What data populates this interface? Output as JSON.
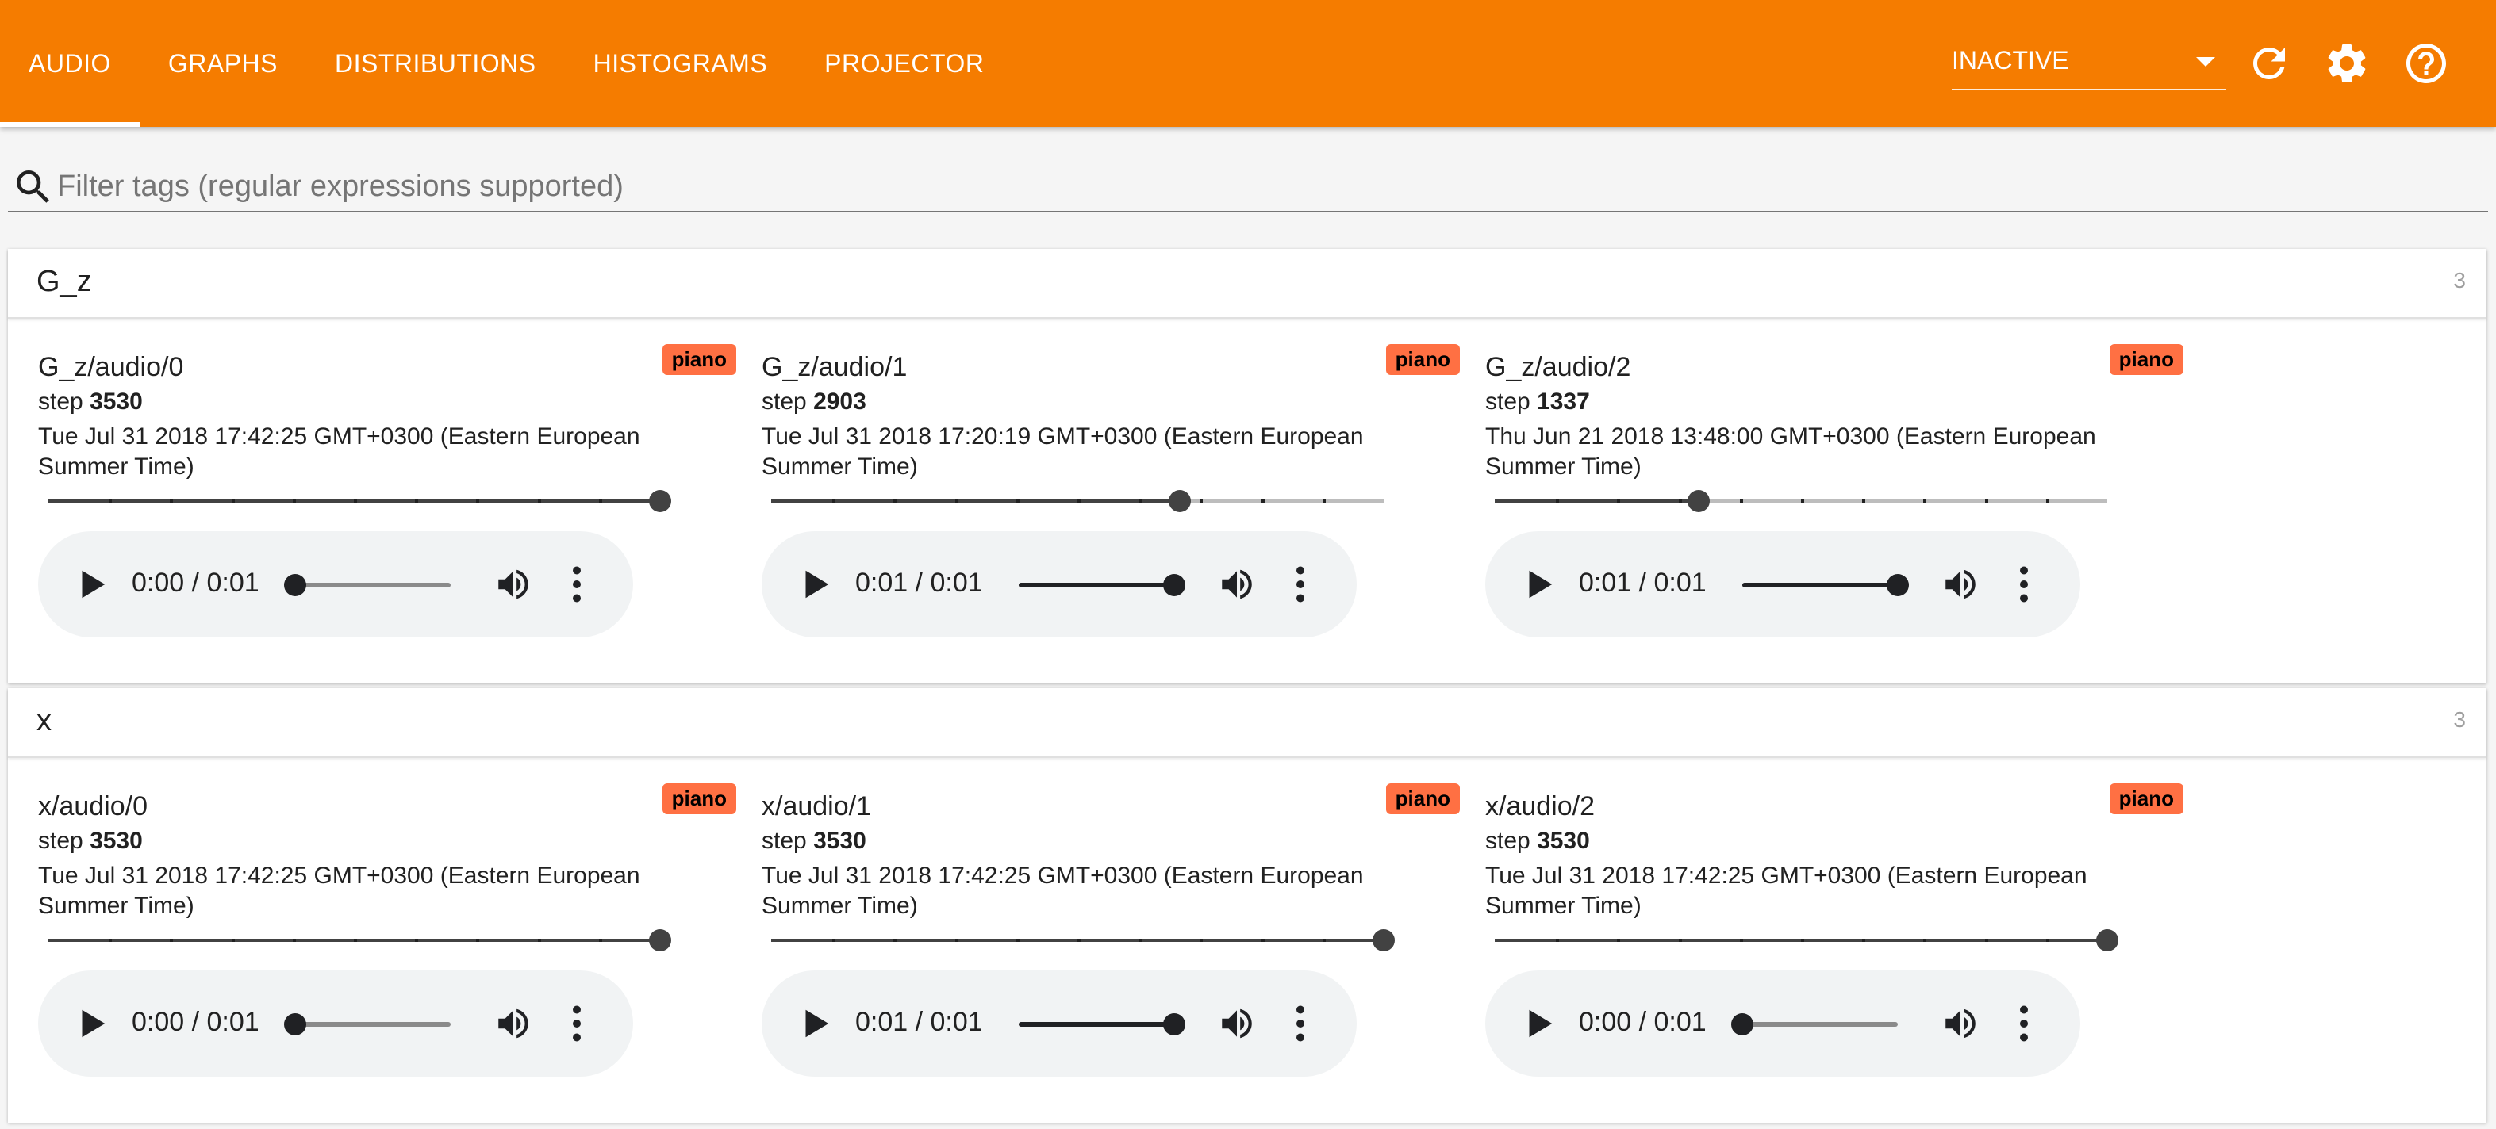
{
  "header": {
    "tabs": [
      {
        "label": "AUDIO",
        "active": true
      },
      {
        "label": "GRAPHS",
        "active": false
      },
      {
        "label": "DISTRIBUTIONS",
        "active": false
      },
      {
        "label": "HISTOGRAMS",
        "active": false
      },
      {
        "label": "PROJECTOR",
        "active": false
      }
    ],
    "run_select": {
      "value": "INACTIVE"
    },
    "icons": [
      "refresh-icon",
      "settings-gear-icon",
      "help-icon"
    ]
  },
  "filter": {
    "placeholder": "Filter tags (regular expressions supported)",
    "value": ""
  },
  "colors": {
    "header_bg": "#f57c00",
    "badge_bg": "#ff7043",
    "player_bg": "#f1f3f4"
  },
  "categories": [
    {
      "name": "G_z",
      "count": "3",
      "cards": [
        {
          "tag": "G_z/audio/0",
          "run": "piano",
          "step_label": "step",
          "step": "3530",
          "wall_time": "Tue Jul 31 2018 17:42:25 GMT+0300 (Eastern European Summer Time)",
          "step_position": 1.0,
          "time": "0:00 / 0:01",
          "playback_progress": 0.0
        },
        {
          "tag": "G_z/audio/1",
          "run": "piano",
          "step_label": "step",
          "step": "2903",
          "wall_time": "Tue Jul 31 2018 17:20:19 GMT+0300 (Eastern European Summer Time)",
          "step_position": 0.667,
          "time": "0:01 / 0:01",
          "playback_progress": 1.0
        },
        {
          "tag": "G_z/audio/2",
          "run": "piano",
          "step_label": "step",
          "step": "1337",
          "wall_time": "Thu Jun 21 2018 13:48:00 GMT+0300 (Eastern European Summer Time)",
          "step_position": 0.333,
          "time": "0:01 / 0:01",
          "playback_progress": 1.0
        }
      ]
    },
    {
      "name": "x",
      "count": "3",
      "cards": [
        {
          "tag": "x/audio/0",
          "run": "piano",
          "step_label": "step",
          "step": "3530",
          "wall_time": "Tue Jul 31 2018 17:42:25 GMT+0300 (Eastern European Summer Time)",
          "step_position": 1.0,
          "time": "0:00 / 0:01",
          "playback_progress": 0.0
        },
        {
          "tag": "x/audio/1",
          "run": "piano",
          "step_label": "step",
          "step": "3530",
          "wall_time": "Tue Jul 31 2018 17:42:25 GMT+0300 (Eastern European Summer Time)",
          "step_position": 1.0,
          "time": "0:01 / 0:01",
          "playback_progress": 1.0
        },
        {
          "tag": "x/audio/2",
          "run": "piano",
          "step_label": "step",
          "step": "3530",
          "wall_time": "Tue Jul 31 2018 17:42:25 GMT+0300 (Eastern European Summer Time)",
          "step_position": 1.0,
          "time": "0:00 / 0:01",
          "playback_progress": 0.0
        }
      ]
    }
  ]
}
